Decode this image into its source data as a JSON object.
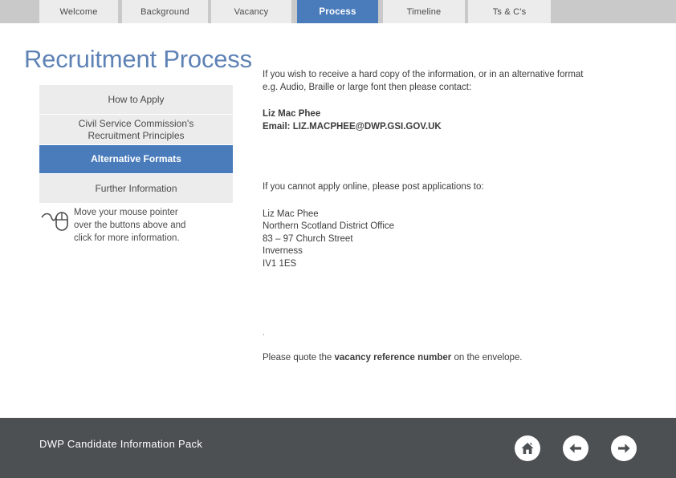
{
  "tabs": [
    {
      "label": "Welcome",
      "active": false
    },
    {
      "label": "Background",
      "active": false
    },
    {
      "label": "Vacancy",
      "active": false
    },
    {
      "label": "Process",
      "active": true
    },
    {
      "label": "Timeline",
      "active": false
    },
    {
      "label": "Ts & C's",
      "active": false
    }
  ],
  "page": {
    "title": "Recruitment Process"
  },
  "menu": {
    "items": [
      {
        "label": "How to Apply",
        "active": false
      },
      {
        "label": "Civil Service Commission's\nRecruitment Principles",
        "active": false
      },
      {
        "label": "Alternative Formats",
        "active": true
      },
      {
        "label": "Further Information",
        "active": false
      }
    ]
  },
  "hint": {
    "icon": "mouse-icon",
    "text": "Move your mouse pointer\nover the buttons above and\nclick for more information."
  },
  "content": {
    "intro_line1": "If you wish to receive a hard copy of the information, or in an alternative format",
    "intro_line2": "e.g. Audio, Braille or large font then please contact:",
    "contact_name": "Liz Mac Phee",
    "contact_email": "Email: LIZ.MACPHEE@DWP.GSI.GOV.UK",
    "post_intro": "If you cannot apply online, please post applications to:",
    "address": [
      "Liz Mac Phee",
      "Northern Scotland District Office",
      "83 – 97 Church Street",
      "Inverness",
      "IV1 1ES"
    ],
    "stray_dot": ".",
    "quote_prefix": "Please quote the ",
    "quote_bold": "vacancy reference number",
    "quote_suffix": " on the envelope."
  },
  "footer": {
    "title": "DWP Candidate Information Pack",
    "nav": [
      {
        "name": "home-icon",
        "label": "Home"
      },
      {
        "name": "arrow-left-icon",
        "label": "Back"
      },
      {
        "name": "arrow-right-icon",
        "label": "Next"
      }
    ]
  },
  "colors": {
    "accent_blue": "#4a7cbc",
    "title_blue": "#5e82b5",
    "tabbar_gray": "#c9c9c9",
    "tab_gray": "#ececec",
    "footer_gray": "#4d5053"
  }
}
